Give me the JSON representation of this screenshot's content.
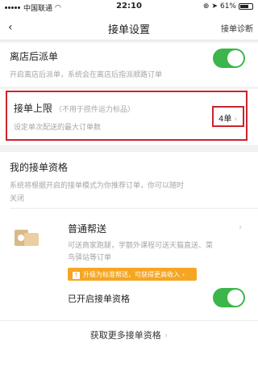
{
  "status_bar": {
    "carrier": "中国联通",
    "time": "22:10",
    "battery": "61%"
  },
  "nav": {
    "title": "接单设置",
    "right_action": "接单诊断"
  },
  "off_store_dispatch": {
    "title": "离店后派单",
    "subtitle": "开启离店后派单，系统会在离店后指派顺路订单",
    "enabled": true
  },
  "order_limit": {
    "title": "接单上限",
    "note": "（不用于揽件运力标品）",
    "subtitle": "设定单次配送的最大订单数",
    "value": "4单"
  },
  "qualification": {
    "title": "我的接单资格",
    "subtitle_line1": "系统将根据开启的接单模式为你推荐订单，你可以随时",
    "subtitle_line2": "关闭"
  },
  "normal_help": {
    "title": "普通帮送",
    "desc_line1": "可送商家跑腿，学额外课程可送天猫直送、菜",
    "desc_line2": "鸟驿站等订单",
    "upgrade": "升级为标准帮送，可获得更高收入",
    "enabled_label": "已开启接单资格",
    "enabled": true
  },
  "more_link": "获取更多接单资格"
}
